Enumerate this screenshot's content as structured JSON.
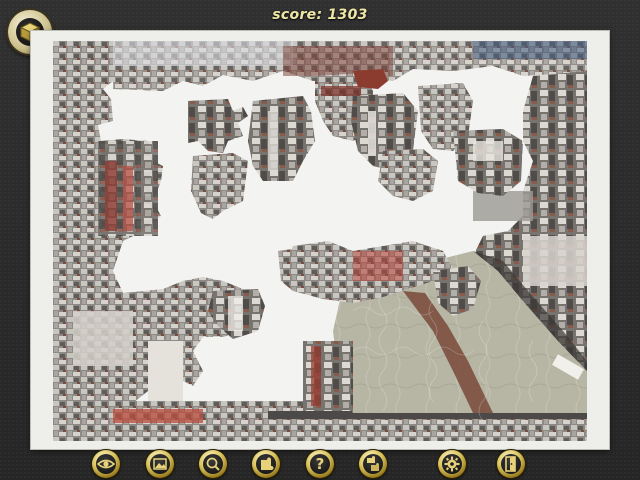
{
  "score": {
    "text": "score: 1303"
  },
  "toolbar": {
    "buttons": [
      {
        "icon": "eye-icon"
      },
      {
        "icon": "picture-preview-icon"
      },
      {
        "icon": "magnifier-icon"
      },
      {
        "icon": "edge-pieces-icon"
      },
      {
        "icon": "help-icon",
        "glyph": "?"
      },
      {
        "icon": "puzzle-pieces-icon"
      },
      {
        "icon": "gear-icon"
      },
      {
        "icon": "exit-door-icon"
      }
    ]
  },
  "colors": {
    "accent_gold": "#d9c35d",
    "score_text": "#efe7a6",
    "board": "#eeeeea",
    "river": "#b9b8a8"
  }
}
